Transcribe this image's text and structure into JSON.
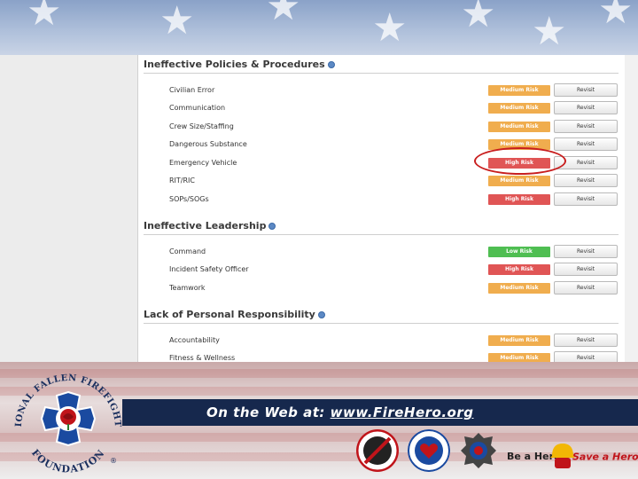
{
  "sections": [
    {
      "title": "Ineffective Policies & Procedures",
      "rows": [
        {
          "label": "Civilian Error",
          "risk": "Medium Risk",
          "level": "medium",
          "action": "Revisit"
        },
        {
          "label": "Communication",
          "risk": "Medium Risk",
          "level": "medium",
          "action": "Revisit"
        },
        {
          "label": "Crew Size/Staffing",
          "risk": "Medium Risk",
          "level": "medium",
          "action": "Revisit"
        },
        {
          "label": "Dangerous Substance",
          "risk": "Medium Risk",
          "level": "medium",
          "action": "Revisit"
        },
        {
          "label": "Emergency Vehicle",
          "risk": "High Risk",
          "level": "high",
          "action": "Revisit"
        },
        {
          "label": "RIT/RIC",
          "risk": "Medium Risk",
          "level": "medium",
          "action": "Revisit"
        },
        {
          "label": "SOPs/SOGs",
          "risk": "High Risk",
          "level": "high",
          "action": "Revisit"
        }
      ]
    },
    {
      "title": "Ineffective Leadership",
      "rows": [
        {
          "label": "Command",
          "risk": "Low Risk",
          "level": "low",
          "action": "Revisit"
        },
        {
          "label": "Incident Safety Officer",
          "risk": "High Risk",
          "level": "high",
          "action": "Revisit"
        },
        {
          "label": "Teamwork",
          "risk": "Medium Risk",
          "level": "medium",
          "action": "Revisit"
        }
      ]
    },
    {
      "title": "Lack of Personal Responsibility",
      "rows": [
        {
          "label": "Accountability",
          "risk": "Medium Risk",
          "level": "medium",
          "action": "Revisit"
        },
        {
          "label": "Fitness & Wellness",
          "risk": "Medium Risk",
          "level": "medium",
          "action": "Revisit"
        }
      ]
    }
  ],
  "footer": {
    "web_prefix": "On the Web at: ",
    "web_url": "www.FireHero.org",
    "org_name_top": "NATIONAL FALLEN FIREFIGHTERS",
    "org_name_bottom": "FOUNDATION",
    "registered_mark": "®",
    "be_a_hero": "Be a Hero",
    "save_a_hero": "Save a Hero",
    "trademark": "®"
  },
  "colors": {
    "medium": "#f0ad4e",
    "high": "#e05555",
    "low": "#4fbe52",
    "footer_bar": "#16284d",
    "highlight": "#c81e1e"
  },
  "icons": [
    "info-icon",
    "star-icon",
    "rose-icon",
    "helmet-icon"
  ]
}
